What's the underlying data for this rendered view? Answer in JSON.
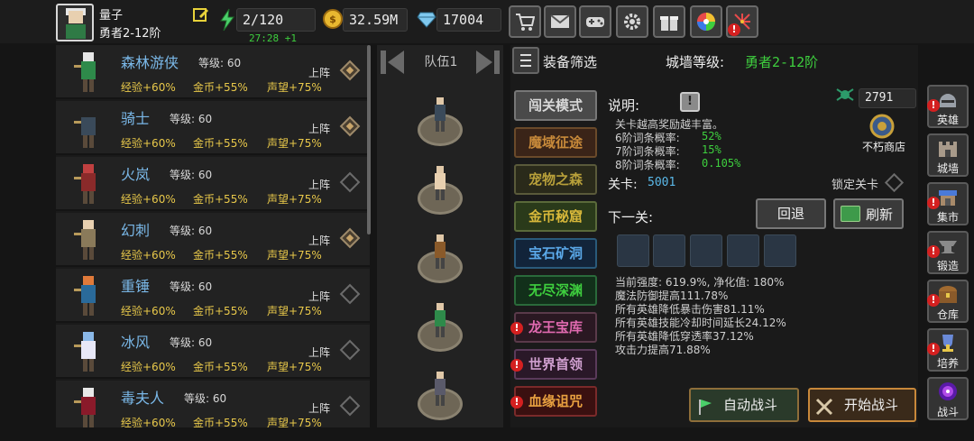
{
  "player": {
    "name": "量子",
    "rank": "勇者2-12阶"
  },
  "resources": {
    "energy": "2/120",
    "energy_timer": "27:28 +1",
    "gold": "32.59M",
    "diamonds": "17004"
  },
  "top_icons": [
    "cart-icon",
    "mail-icon",
    "gamepad-icon",
    "settings-icon",
    "gift-icon",
    "color-wheel-icon",
    "fireworks-icon"
  ],
  "heroes": [
    {
      "name": "森林游侠",
      "level": "等级: 60",
      "deploy": "上阵",
      "selected": true,
      "exp": "经验+60%",
      "gold": "金币+55%",
      "fame": "声望+75%"
    },
    {
      "name": "骑士",
      "level": "等级: 60",
      "deploy": "上阵",
      "selected": true,
      "exp": "经验+60%",
      "gold": "金币+55%",
      "fame": "声望+75%"
    },
    {
      "name": "火岚",
      "level": "等级: 60",
      "deploy": "上阵",
      "selected": false,
      "exp": "经验+60%",
      "gold": "金币+55%",
      "fame": "声望+75%"
    },
    {
      "name": "幻刺",
      "level": "等级: 60",
      "deploy": "上阵",
      "selected": true,
      "exp": "经验+60%",
      "gold": "金币+55%",
      "fame": "声望+75%"
    },
    {
      "name": "重锤",
      "level": "等级: 60",
      "deploy": "上阵",
      "selected": false,
      "exp": "经验+60%",
      "gold": "金币+55%",
      "fame": "声望+75%"
    },
    {
      "name": "冰风",
      "level": "等级: 60",
      "deploy": "上阵",
      "selected": false,
      "exp": "经验+60%",
      "gold": "金币+55%",
      "fame": "声望+75%"
    },
    {
      "name": "毒夫人",
      "level": "等级: 60",
      "deploy": "上阵",
      "selected": false,
      "exp": "经验+60%",
      "gold": "金币+55%",
      "fame": "声望+75%"
    }
  ],
  "team": {
    "label": "队伍1"
  },
  "filter": {
    "label": "装备筛选",
    "wall_level_label": "城墙等级:",
    "wall_level_value": "勇者2-12阶"
  },
  "modes": [
    {
      "label": "闯关模式",
      "warn": false
    },
    {
      "label": "魔域征途",
      "warn": false
    },
    {
      "label": "宠物之森",
      "warn": false
    },
    {
      "label": "金币秘窟",
      "warn": false
    },
    {
      "label": "宝石矿洞",
      "warn": false
    },
    {
      "label": "无尽深渊",
      "warn": false
    },
    {
      "label": "龙王宝库",
      "warn": true
    },
    {
      "label": "世界首领",
      "warn": true
    },
    {
      "label": "血缘诅咒",
      "warn": true
    }
  ],
  "info": {
    "desc_label": "说明:",
    "currency_value": "2791",
    "shop_label": "不朽商店",
    "line1": "关卡越高奖励越丰富。",
    "rate6_label": "6阶词条概率:",
    "rate6_value": "52%",
    "rate7_label": "7阶词条概率:",
    "rate7_value": "15%",
    "rate8_label": "8阶词条概率:",
    "rate8_value": "0.105%",
    "stage_label": "关卡:",
    "stage_value": "5001",
    "lock_label": "锁定关卡",
    "next_label": "下一关:",
    "back_label": "回退",
    "refresh_label": "刷新",
    "stats": [
      "当前强度: 619.9%, 净化值: 180%",
      "魔法防御提高111.78%",
      "所有英雄降低暴击伤害81.11%",
      "所有英雄技能冷却时间延长24.12%",
      "所有英雄降低穿透率37.12%",
      "攻击力提高71.88%"
    ],
    "auto_label": "自动战斗",
    "start_label": "开始战斗"
  },
  "side_nav": [
    {
      "label": "英雄",
      "icon": "helmet-icon",
      "warn": true
    },
    {
      "label": "城墙",
      "icon": "castle-icon",
      "warn": false
    },
    {
      "label": "集市",
      "icon": "market-icon",
      "warn": true
    },
    {
      "label": "锻造",
      "icon": "anvil-icon",
      "warn": true
    },
    {
      "label": "仓库",
      "icon": "chest-icon",
      "warn": true
    },
    {
      "label": "培养",
      "icon": "trophy-icon",
      "warn": true
    },
    {
      "label": "战斗",
      "icon": "portal-icon",
      "warn": false
    }
  ],
  "colors": {
    "accent_green": "#3ecf3e",
    "bonus_yellow": "#e8c84a",
    "name_blue": "#7ab8e8",
    "warn_red": "#d42020"
  }
}
